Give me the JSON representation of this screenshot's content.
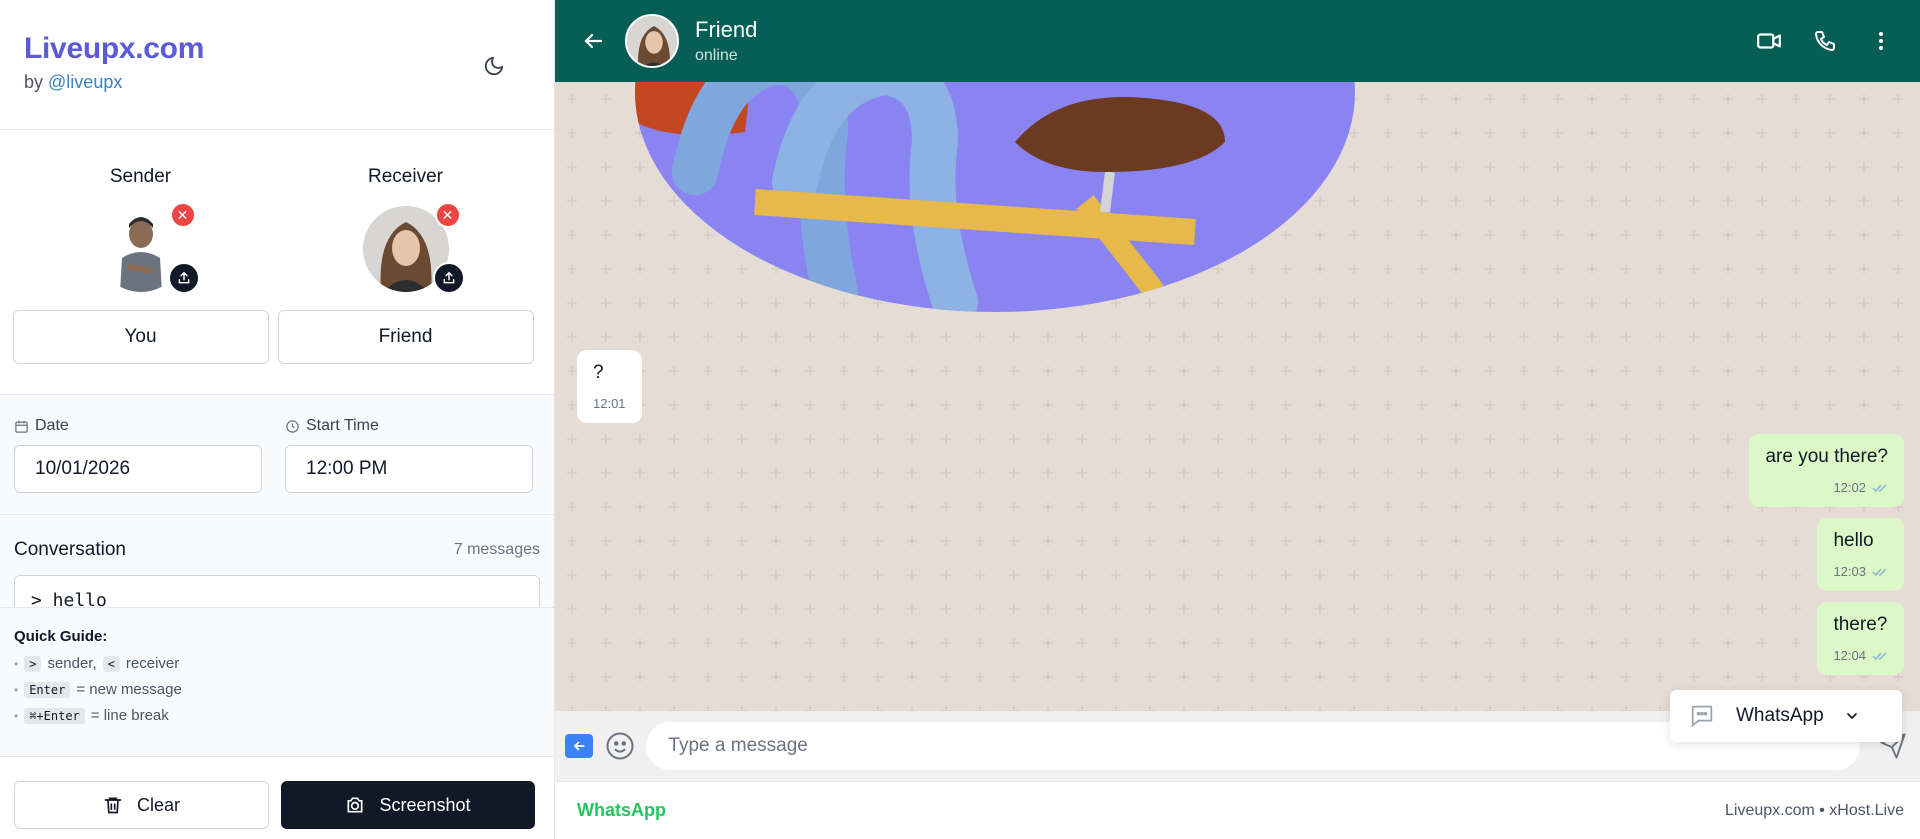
{
  "brand": {
    "title": "Liveupx.com",
    "by_prefix": "by",
    "handle": "@liveupx"
  },
  "people": {
    "sender": {
      "label": "Sender",
      "name": "You"
    },
    "receiver": {
      "label": "Receiver",
      "name": "Friend"
    }
  },
  "datetime": {
    "date_label": "Date",
    "date_value": "10/01/2026",
    "time_label": "Start Time",
    "time_value": "12:00 PM"
  },
  "conversation": {
    "title": "Conversation",
    "count": "7 messages",
    "text": "> hello"
  },
  "guide": {
    "title": "Quick Guide:",
    "line1_k1": ">",
    "line1_t1": "sender,",
    "line1_k2": "<",
    "line1_t2": "receiver",
    "line2_k": "Enter",
    "line2_t": "= new message",
    "line3_k": "⌘+Enter",
    "line3_t": "= line break"
  },
  "actions": {
    "clear": "Clear",
    "screenshot": "Screenshot"
  },
  "chat": {
    "contact_name": "Friend",
    "status": "online",
    "messages": [
      {
        "text": "?",
        "time": "12:01"
      },
      {
        "text": "are you there?",
        "time": "12:02"
      },
      {
        "text": "hello",
        "time": "12:03"
      },
      {
        "text": "there?",
        "time": "12:04"
      }
    ],
    "placeholder": "Type a message",
    "source": "WhatsApp"
  },
  "footer": {
    "left": "WhatsApp",
    "right": "Liveupx.com • xHost.Live"
  },
  "colors": {
    "brand": "#5b5bd6",
    "header": "#075e54",
    "sent_bubble": "#dcf8c6",
    "whatsapp_green": "#22c55e"
  },
  "icons": [
    "moon-icon",
    "close-icon",
    "upload-icon",
    "calendar-icon",
    "clock-icon",
    "trash-icon",
    "camera-icon",
    "back-arrow-icon",
    "video-icon",
    "phone-icon",
    "more-vertical-icon",
    "emoji-icon",
    "send-icon",
    "chat-bubble-icon",
    "chevron-down-icon"
  ]
}
